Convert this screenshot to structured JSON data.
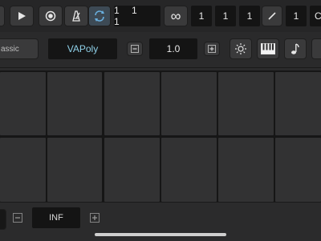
{
  "transport": {
    "position": "1 1 1",
    "loop_symbol": "∞",
    "value_a": "1",
    "value_b": "1",
    "value_c": "1",
    "value_d": "1",
    "partial_label": "C"
  },
  "instrument": {
    "preset_name": "assic",
    "instrument_name": "VAPoly",
    "value": "1.0"
  },
  "bottom": {
    "value": "INF"
  },
  "colors": {
    "accent_loop": "#6ab0e0",
    "instrument_text": "#8fd0e8"
  },
  "icons": [
    "play-icon",
    "record-icon",
    "metronome-icon",
    "loop-icon",
    "pencil-icon",
    "minus-icon",
    "plus-icon",
    "sun-icon",
    "piano-icon",
    "note-icon"
  ]
}
